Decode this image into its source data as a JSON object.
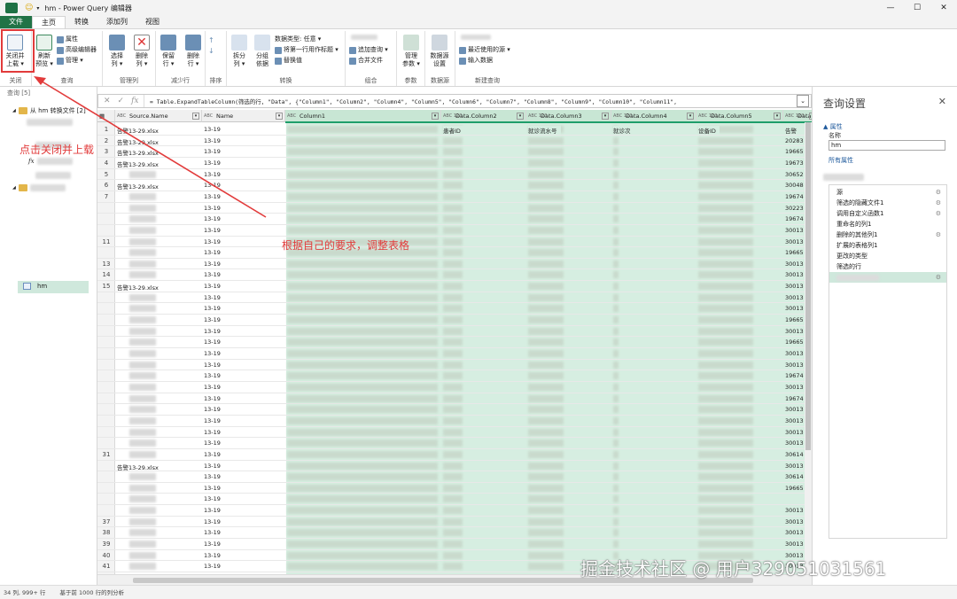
{
  "window": {
    "title": "hm - Power Query 编辑器",
    "min": "—",
    "max": "☐",
    "close": "✕"
  },
  "ribbon_tabs": [
    {
      "label": "文件"
    },
    {
      "label": "主页"
    },
    {
      "label": "转换"
    },
    {
      "label": "添加列"
    },
    {
      "label": "视图"
    }
  ],
  "ribbon": {
    "close": {
      "btn_line1": "关闭并",
      "btn_line2": "上载 ▾",
      "group": "关闭"
    },
    "query": {
      "refresh_line1": "刷新",
      "refresh_line2": "预览 ▾",
      "props": "属性",
      "adv_editor": "高级编辑器",
      "manage": "管理 ▾",
      "group": "查询"
    },
    "manage_cols": {
      "choose_line1": "选择",
      "choose_line2": "列 ▾",
      "remove_line1": "删除",
      "remove_line2": "列 ▾",
      "group": "管理列"
    },
    "reduce_rows": {
      "keep_line1": "保留",
      "keep_line2": "行 ▾",
      "del_line1": "删除",
      "del_line2": "行 ▾",
      "group": "减少行"
    },
    "sort": {
      "group": "排序"
    },
    "transform": {
      "split_line1": "拆分",
      "split_line2": "列 ▾",
      "group_line1": "分组",
      "group_line2": "依据",
      "datatype": "数据类型: 任意 ▾",
      "first_row_header": "将第一行用作标题 ▾",
      "replace": "替换值",
      "group": "转换"
    },
    "combine": {
      "append": "追加查询 ▾",
      "merge_files": "合并文件",
      "group": "组合"
    },
    "params": {
      "manage_line1": "管理",
      "manage_line2": "参数 ▾",
      "group": "参数"
    },
    "datasource": {
      "line1": "数据源",
      "line2": "设置",
      "group": "数据源"
    },
    "new_query": {
      "recent": "最近使用的源 ▾",
      "enter_data": "输入数据",
      "group": "新建查询"
    }
  },
  "formula": {
    "cancel": "✕",
    "confirm": "✓",
    "fx": "fx",
    "text": "= Table.ExpandTableColumn(筛选的行, \"Data\", {\"Column1\", \"Column2\",              \"Column4\", \"Column5\", \"Column6\", \"Column7\", \"Column8\", \"Column9\", \"Column10\", \"Column11\","
  },
  "nav": {
    "header": "查询 [5]",
    "folder1": "从 hm 转换文件 [2]",
    "fx": "fx",
    "hm": "hm"
  },
  "grid": {
    "columns": [
      {
        "type": "ABC",
        "name": "Source.Name"
      },
      {
        "type": "ABC",
        "name": "Name"
      },
      {
        "type": "ABC",
        "name": "Column1"
      },
      {
        "type": "ABC 123",
        "name": "Data.Column2"
      },
      {
        "type": "ABC 123",
        "name": "Data.Column3"
      },
      {
        "type": "ABC 123",
        "name": "Data.Column4"
      },
      {
        "type": "ABC 123",
        "name": "Data.Column5"
      },
      {
        "type": "ABC 123",
        "name": "Data"
      }
    ],
    "sub_header": [
      "患者ID",
      "就诊流水号",
      "就诊次",
      "设备ID",
      "告警"
    ],
    "rows": [
      {
        "n": "1",
        "src": "告警13-29.xlsx",
        "name": "13-19",
        "last": "告警"
      },
      {
        "n": "2",
        "src": "告警13-29.xlsx",
        "name": "13-19",
        "last": "20283"
      },
      {
        "n": "3",
        "src": "告警13-29.xlsx",
        "name": "13-19",
        "last": "19665"
      },
      {
        "n": "4",
        "src": "告警13-29.xlsx",
        "name": "13-19",
        "last": "19673"
      },
      {
        "n": "5",
        "src": "",
        "name": "13-19",
        "last": "30652"
      },
      {
        "n": "6",
        "src": "告警13-29.xlsx",
        "name": "13-19",
        "last": "30048"
      },
      {
        "n": "7",
        "src": "",
        "name": "13-19",
        "last": "19674"
      },
      {
        "n": "",
        "src": "",
        "name": "13-19",
        "last": "30223"
      },
      {
        "n": "",
        "src": "",
        "name": "13-19",
        "last": "19674"
      },
      {
        "n": "",
        "src": "",
        "name": "13-19",
        "last": "30013"
      },
      {
        "n": "11",
        "src": "",
        "name": "13-19",
        "last": "30013"
      },
      {
        "n": "",
        "src": "",
        "name": "13-19",
        "last": "19665"
      },
      {
        "n": "13",
        "src": "",
        "name": "13-19",
        "last": "30013"
      },
      {
        "n": "14",
        "src": "",
        "name": "13-19",
        "last": "30013"
      },
      {
        "n": "15",
        "src": "告警13-29.xlsx",
        "name": "13-19",
        "last": "30013"
      },
      {
        "n": "",
        "src": "",
        "name": "13-19",
        "last": "30013"
      },
      {
        "n": "",
        "src": "",
        "name": "13-19",
        "last": "30013"
      },
      {
        "n": "",
        "src": "",
        "name": "13-19",
        "last": "19665"
      },
      {
        "n": "",
        "src": "",
        "name": "13-19",
        "last": "30013"
      },
      {
        "n": "",
        "src": "",
        "name": "13-19",
        "last": "19665"
      },
      {
        "n": "",
        "src": "",
        "name": "13-19",
        "last": "30013"
      },
      {
        "n": "",
        "src": "",
        "name": "13-19",
        "last": "30013"
      },
      {
        "n": "",
        "src": "",
        "name": "13-19",
        "last": "19674"
      },
      {
        "n": "",
        "src": "",
        "name": "13-19",
        "last": "30013"
      },
      {
        "n": "",
        "src": "",
        "name": "13-19",
        "last": "19674"
      },
      {
        "n": "",
        "src": "",
        "name": "13-19",
        "last": "30013"
      },
      {
        "n": "",
        "src": "",
        "name": "13-19",
        "last": "30013"
      },
      {
        "n": "",
        "src": "",
        "name": "13-19",
        "last": "30013"
      },
      {
        "n": "",
        "src": "",
        "name": "13-19",
        "last": "30013"
      },
      {
        "n": "31",
        "src": "",
        "name": "13-19",
        "last": "30614"
      },
      {
        "n": "",
        "src": "告警13-29.xlsx",
        "name": "13-19",
        "last": "30013"
      },
      {
        "n": "",
        "src": "",
        "name": "13-19",
        "last": "30614"
      },
      {
        "n": "",
        "src": "",
        "name": "13-19",
        "last": "19665"
      },
      {
        "n": "",
        "src": "",
        "name": "13-19",
        "last": ""
      },
      {
        "n": "",
        "src": "",
        "name": "13-19",
        "last": "30013"
      },
      {
        "n": "37",
        "src": "",
        "name": "13-19",
        "last": "30013"
      },
      {
        "n": "38",
        "src": "",
        "name": "13-19",
        "last": "30013"
      },
      {
        "n": "39",
        "src": "",
        "name": "13-19",
        "last": "30013"
      },
      {
        "n": "40",
        "src": "",
        "name": "13-19",
        "last": "30013"
      },
      {
        "n": "41",
        "src": "",
        "name": "13-19",
        "last": "30013"
      }
    ]
  },
  "status": {
    "cols": "34 列, 999+ 行",
    "profile": "基于前 1000 行的列分析"
  },
  "query_settings": {
    "title": "查询设置",
    "close": "✕",
    "props_section": "▲ 属性",
    "name_label": "名称",
    "name_value": "hm",
    "all_props": "所有属性",
    "steps": [
      {
        "label": "源",
        "gear": true
      },
      {
        "label": "筛选的隐藏文件1",
        "gear": true
      },
      {
        "label": "调用自定义函数1",
        "gear": true
      },
      {
        "label": "重命名的列1",
        "gear": false
      },
      {
        "label": "删除的其他列1",
        "gear": true
      },
      {
        "label": "扩展的表格列1",
        "gear": false
      },
      {
        "label": "更改的类型",
        "gear": false
      },
      {
        "label": "筛选的行",
        "gear": false
      },
      {
        "label": "",
        "gear": true
      }
    ]
  },
  "annotations": {
    "click_close": "点击关闭并上载",
    "adjust_table": "根据自己的要求，调整表格"
  },
  "watermark": "掘金技术社区 @ 用户329051031561",
  "colors": {
    "accent": "#217346",
    "annotation": "#e23b3b",
    "selected": "#cfe8dc",
    "column_highlight": "#d6eee1"
  }
}
